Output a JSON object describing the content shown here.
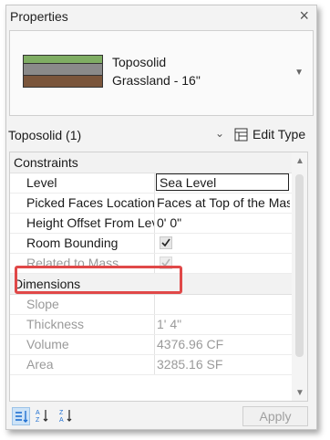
{
  "window": {
    "title": "Properties",
    "close_glyph": "×"
  },
  "type_selector": {
    "family": "Toposolid",
    "type": "Grassland - 16\"",
    "swatch_colors": [
      "#7fad63",
      "#8a8a8a",
      "#7a553b"
    ]
  },
  "instance": {
    "label": "Toposolid (1)",
    "edit_type_label": "Edit Type"
  },
  "sections": {
    "constraints": "Constraints",
    "dimensions": "Dimensions"
  },
  "constraints": {
    "level": {
      "label": "Level",
      "value": "Sea Level"
    },
    "picked_faces": {
      "label": "Picked Faces Location",
      "value": "Faces at Top of the Mass"
    },
    "height_offset": {
      "label": "Height Offset From Level",
      "value": "0'  0\""
    },
    "room_bounding": {
      "label": "Room Bounding",
      "checked": true
    },
    "related_to_mass": {
      "label": "Related to Mass",
      "checked": true
    }
  },
  "dimensions": {
    "slope": {
      "label": "Slope",
      "value": ""
    },
    "thickness": {
      "label": "Thickness",
      "value": "1'  4\""
    },
    "volume": {
      "label": "Volume",
      "value": "4376.96 CF"
    },
    "area": {
      "label": "Area",
      "value": "3285.16 SF"
    }
  },
  "footer": {
    "apply_label": "Apply"
  },
  "colors": {
    "highlight": "#e04848",
    "active_sort": "#cde3f7"
  }
}
